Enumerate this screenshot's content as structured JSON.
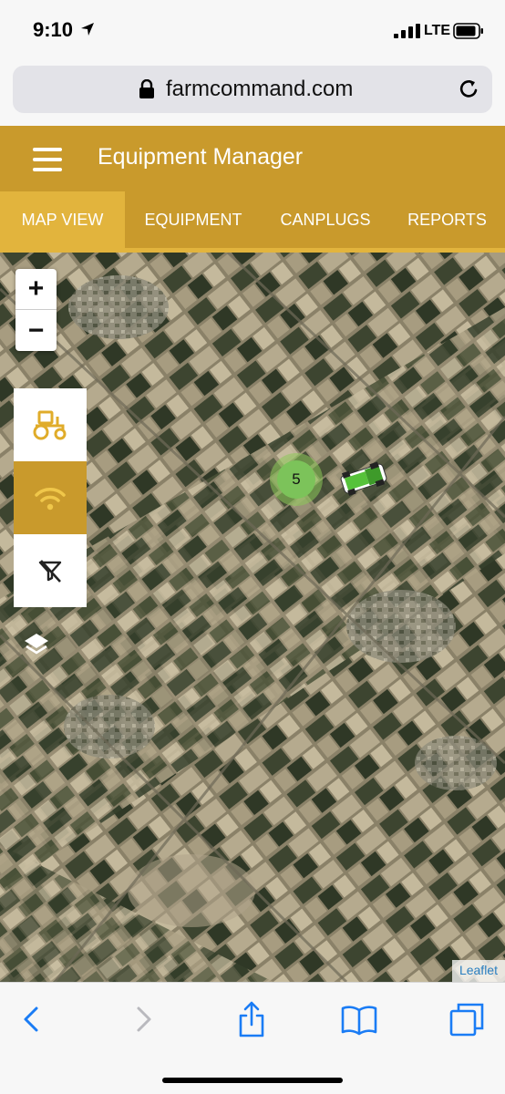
{
  "status_bar": {
    "time": "9:10",
    "network": "LTE"
  },
  "browser": {
    "url": "farmcommand.com"
  },
  "app": {
    "title": "Equipment Manager",
    "accent_color": "#c99a2c",
    "active_tab_color": "#e2b43d"
  },
  "tabs": [
    {
      "label": "MAP VIEW",
      "active": true
    },
    {
      "label": "EQUIPMENT",
      "active": false
    },
    {
      "label": "CANPLUGS",
      "active": false
    },
    {
      "label": "REPORTS",
      "active": false
    }
  ],
  "map": {
    "zoom_in_label": "+",
    "zoom_out_label": "−",
    "cluster_count": "5",
    "attribution": "Leaflet",
    "tools": [
      {
        "icon": "tractor-icon",
        "active": false
      },
      {
        "icon": "wifi-signal-icon",
        "active": true
      },
      {
        "icon": "filter-off-icon",
        "active": false
      }
    ]
  },
  "toolbar": {
    "icons": [
      "back-icon",
      "forward-icon",
      "share-icon",
      "bookmarks-icon",
      "tabs-icon"
    ]
  }
}
